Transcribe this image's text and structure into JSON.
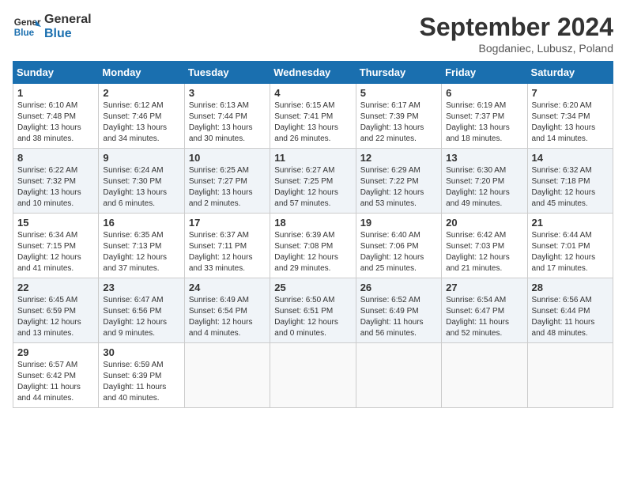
{
  "header": {
    "logo_line1": "General",
    "logo_line2": "Blue",
    "month_title": "September 2024",
    "location": "Bogdaniec, Lubusz, Poland"
  },
  "weekdays": [
    "Sunday",
    "Monday",
    "Tuesday",
    "Wednesday",
    "Thursday",
    "Friday",
    "Saturday"
  ],
  "weeks": [
    [
      {
        "day": 1,
        "info": "Sunrise: 6:10 AM\nSunset: 7:48 PM\nDaylight: 13 hours\nand 38 minutes."
      },
      {
        "day": 2,
        "info": "Sunrise: 6:12 AM\nSunset: 7:46 PM\nDaylight: 13 hours\nand 34 minutes."
      },
      {
        "day": 3,
        "info": "Sunrise: 6:13 AM\nSunset: 7:44 PM\nDaylight: 13 hours\nand 30 minutes."
      },
      {
        "day": 4,
        "info": "Sunrise: 6:15 AM\nSunset: 7:41 PM\nDaylight: 13 hours\nand 26 minutes."
      },
      {
        "day": 5,
        "info": "Sunrise: 6:17 AM\nSunset: 7:39 PM\nDaylight: 13 hours\nand 22 minutes."
      },
      {
        "day": 6,
        "info": "Sunrise: 6:19 AM\nSunset: 7:37 PM\nDaylight: 13 hours\nand 18 minutes."
      },
      {
        "day": 7,
        "info": "Sunrise: 6:20 AM\nSunset: 7:34 PM\nDaylight: 13 hours\nand 14 minutes."
      }
    ],
    [
      {
        "day": 8,
        "info": "Sunrise: 6:22 AM\nSunset: 7:32 PM\nDaylight: 13 hours\nand 10 minutes."
      },
      {
        "day": 9,
        "info": "Sunrise: 6:24 AM\nSunset: 7:30 PM\nDaylight: 13 hours\nand 6 minutes."
      },
      {
        "day": 10,
        "info": "Sunrise: 6:25 AM\nSunset: 7:27 PM\nDaylight: 13 hours\nand 2 minutes."
      },
      {
        "day": 11,
        "info": "Sunrise: 6:27 AM\nSunset: 7:25 PM\nDaylight: 12 hours\nand 57 minutes."
      },
      {
        "day": 12,
        "info": "Sunrise: 6:29 AM\nSunset: 7:22 PM\nDaylight: 12 hours\nand 53 minutes."
      },
      {
        "day": 13,
        "info": "Sunrise: 6:30 AM\nSunset: 7:20 PM\nDaylight: 12 hours\nand 49 minutes."
      },
      {
        "day": 14,
        "info": "Sunrise: 6:32 AM\nSunset: 7:18 PM\nDaylight: 12 hours\nand 45 minutes."
      }
    ],
    [
      {
        "day": 15,
        "info": "Sunrise: 6:34 AM\nSunset: 7:15 PM\nDaylight: 12 hours\nand 41 minutes."
      },
      {
        "day": 16,
        "info": "Sunrise: 6:35 AM\nSunset: 7:13 PM\nDaylight: 12 hours\nand 37 minutes."
      },
      {
        "day": 17,
        "info": "Sunrise: 6:37 AM\nSunset: 7:11 PM\nDaylight: 12 hours\nand 33 minutes."
      },
      {
        "day": 18,
        "info": "Sunrise: 6:39 AM\nSunset: 7:08 PM\nDaylight: 12 hours\nand 29 minutes."
      },
      {
        "day": 19,
        "info": "Sunrise: 6:40 AM\nSunset: 7:06 PM\nDaylight: 12 hours\nand 25 minutes."
      },
      {
        "day": 20,
        "info": "Sunrise: 6:42 AM\nSunset: 7:03 PM\nDaylight: 12 hours\nand 21 minutes."
      },
      {
        "day": 21,
        "info": "Sunrise: 6:44 AM\nSunset: 7:01 PM\nDaylight: 12 hours\nand 17 minutes."
      }
    ],
    [
      {
        "day": 22,
        "info": "Sunrise: 6:45 AM\nSunset: 6:59 PM\nDaylight: 12 hours\nand 13 minutes."
      },
      {
        "day": 23,
        "info": "Sunrise: 6:47 AM\nSunset: 6:56 PM\nDaylight: 12 hours\nand 9 minutes."
      },
      {
        "day": 24,
        "info": "Sunrise: 6:49 AM\nSunset: 6:54 PM\nDaylight: 12 hours\nand 4 minutes."
      },
      {
        "day": 25,
        "info": "Sunrise: 6:50 AM\nSunset: 6:51 PM\nDaylight: 12 hours\nand 0 minutes."
      },
      {
        "day": 26,
        "info": "Sunrise: 6:52 AM\nSunset: 6:49 PM\nDaylight: 11 hours\nand 56 minutes."
      },
      {
        "day": 27,
        "info": "Sunrise: 6:54 AM\nSunset: 6:47 PM\nDaylight: 11 hours\nand 52 minutes."
      },
      {
        "day": 28,
        "info": "Sunrise: 6:56 AM\nSunset: 6:44 PM\nDaylight: 11 hours\nand 48 minutes."
      }
    ],
    [
      {
        "day": 29,
        "info": "Sunrise: 6:57 AM\nSunset: 6:42 PM\nDaylight: 11 hours\nand 44 minutes."
      },
      {
        "day": 30,
        "info": "Sunrise: 6:59 AM\nSunset: 6:39 PM\nDaylight: 11 hours\nand 40 minutes."
      },
      null,
      null,
      null,
      null,
      null
    ]
  ]
}
